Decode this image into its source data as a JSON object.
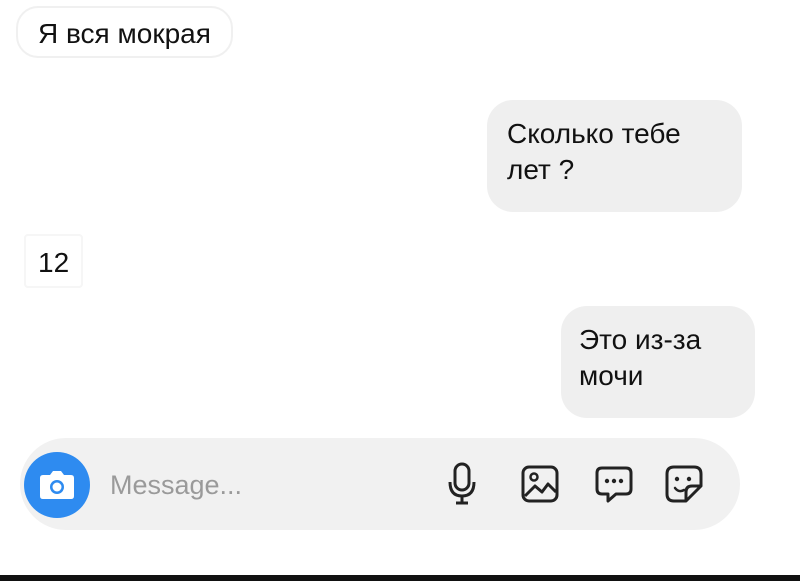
{
  "conversation": {
    "messages": [
      {
        "direction": "incoming",
        "text": "Я вся мокрая"
      },
      {
        "direction": "outgoing",
        "text_lines": [
          "Сколько тебе",
          "лет ?"
        ]
      },
      {
        "direction": "incoming",
        "text": "12"
      },
      {
        "direction": "outgoing",
        "text_lines": [
          "Это из-за",
          "мочи"
        ]
      }
    ]
  },
  "composer": {
    "placeholder": "Message...",
    "icons": [
      "camera-icon",
      "microphone-icon",
      "gallery-icon",
      "chat-options-icon",
      "sticker-icon"
    ],
    "accent_color": "#2e8bf0"
  }
}
